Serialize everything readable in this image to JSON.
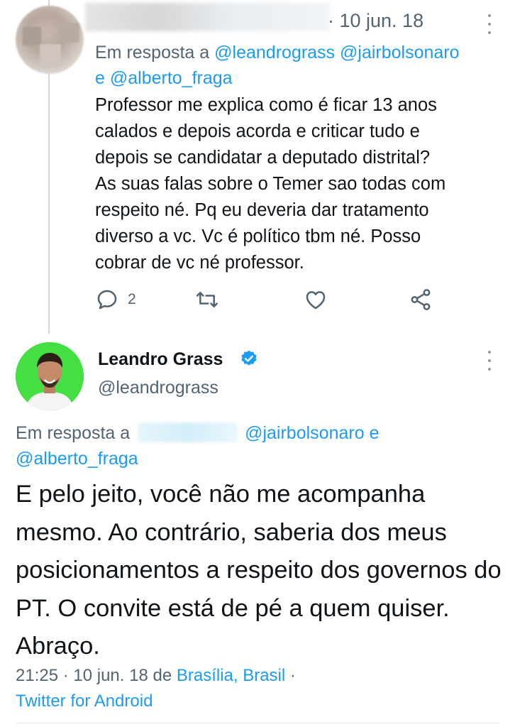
{
  "reply_tweet": {
    "date": "· 10 jun. 18",
    "reply_to_prefix": "Em resposta a",
    "reply_to_mention_1": "@leandrograss",
    "reply_to_mention_2": "@jairbolsonaro",
    "reply_to_conjunction": "e",
    "reply_to_mention_3": "@alberto_fraga",
    "text": "Professor me explica como é ficar 13 anos\ncalados e depois acorda e criticar tudo e\ndepois se candidatar a deputado distrital?\nAs suas falas sobre o Temer sao todas com\nrespeito né. Pq eu deveria dar tratamento\ndiverso a vc. Vc é político tbm né. Posso\ncobrar de vc né professor.",
    "reply_count": "2",
    "icons": [
      "reply-icon",
      "retweet-icon",
      "like-icon",
      "share-icon",
      "more-icon"
    ]
  },
  "main_tweet": {
    "author_name": "Leandro Grass",
    "handle": "@leandrograss",
    "reply_to_prefix": "Em resposta a",
    "reply_to_mention_1": "@jairbolsonaro",
    "reply_to_conjunction": "e",
    "reply_to_mention_2": "@alberto_fraga",
    "text": "E pelo jeito, você não me acompanha mesmo. Ao contrário, saberia dos meus posicionamentos a respeito dos governos do PT. O convite está de pé a quem quiser. Abraço.",
    "time_date": "21:25 · 10 jun. 18 de",
    "location": "Brasília, Brasil",
    "location_sep": "·",
    "source": "Twitter for Android",
    "icons": [
      "verified-badge-icon",
      "more-icon"
    ]
  },
  "colors": {
    "link": "#1d9bf0",
    "secondary_text": "#536471",
    "avatar_background": "#44e043"
  }
}
